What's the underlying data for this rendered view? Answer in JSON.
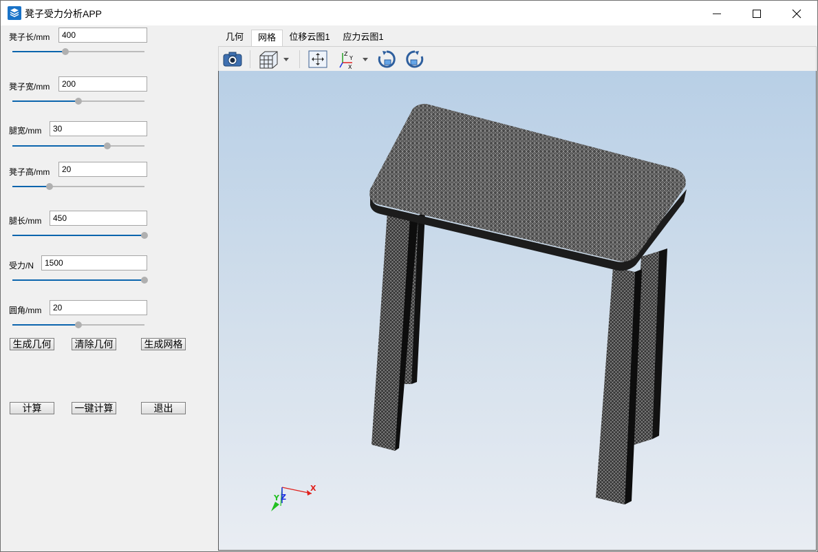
{
  "window": {
    "title": "凳子受力分析APP",
    "controls": [
      "minimize",
      "maximize",
      "close"
    ]
  },
  "params": [
    {
      "label": "凳子长/mm",
      "value": "400",
      "slider_fraction": 0.4
    },
    {
      "label": "凳子宽/mm",
      "value": "200",
      "slider_fraction": 0.5
    },
    {
      "label": "腿宽/mm",
      "value": "30",
      "slider_fraction": 0.72
    },
    {
      "label": "凳子高/mm",
      "value": "20",
      "slider_fraction": 0.28
    },
    {
      "label": "腿长/mm",
      "value": "450",
      "slider_fraction": 1.0
    },
    {
      "label": "受力/N",
      "value": "1500",
      "slider_fraction": 1.0
    },
    {
      "label": "圆角/mm",
      "value": "20",
      "slider_fraction": 0.5
    }
  ],
  "buttons_row1": [
    "生成几何",
    "清除几何",
    "生成网格"
  ],
  "buttons_row2": [
    "计算",
    "一键计算",
    "退出"
  ],
  "tabs": [
    {
      "label": "几何",
      "active": false
    },
    {
      "label": "网格",
      "active": true
    },
    {
      "label": "位移云图1",
      "active": false
    },
    {
      "label": "应力云图1",
      "active": false
    }
  ],
  "toolbar": [
    "camera-icon",
    "view-cube-icon",
    "fit-view-icon",
    "axes-orientation-icon",
    "rotate-cw-icon",
    "rotate-ccw-icon"
  ],
  "triad": {
    "x": "X",
    "y": "Y",
    "z": "Z"
  },
  "colors": {
    "accent": "#0a64ad",
    "axis_x": "#e0201c",
    "axis_y": "#22c022",
    "axis_z": "#1a2fe0",
    "mesh": "#3a3a3a"
  }
}
